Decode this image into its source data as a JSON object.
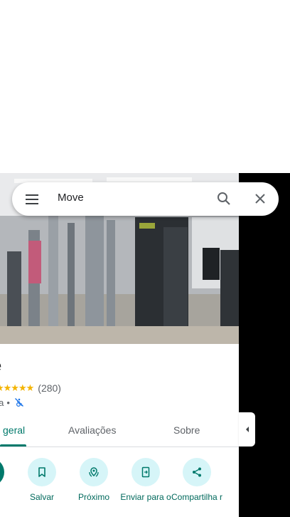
{
  "search": {
    "query": "Move"
  },
  "place": {
    "title": "e",
    "stars": "★★★★★",
    "review_count": "(280)",
    "category": "nia",
    "separator": "•"
  },
  "tabs": [
    "geral",
    "Avaliações",
    "Sobre"
  ],
  "actions": [
    "s",
    "Salvar",
    "Próximo",
    "Enviar para o",
    "Compartilha r"
  ],
  "colors": {
    "accent": "#00796b",
    "action_bg": "#d6f5f8",
    "stars": "#f4b400"
  },
  "icons": [
    "menu-icon",
    "search-icon",
    "close-icon",
    "not-accessible-icon",
    "bookmark-icon",
    "nearby-icon",
    "send-to-phone-icon",
    "share-icon",
    "caret-left-icon"
  ]
}
